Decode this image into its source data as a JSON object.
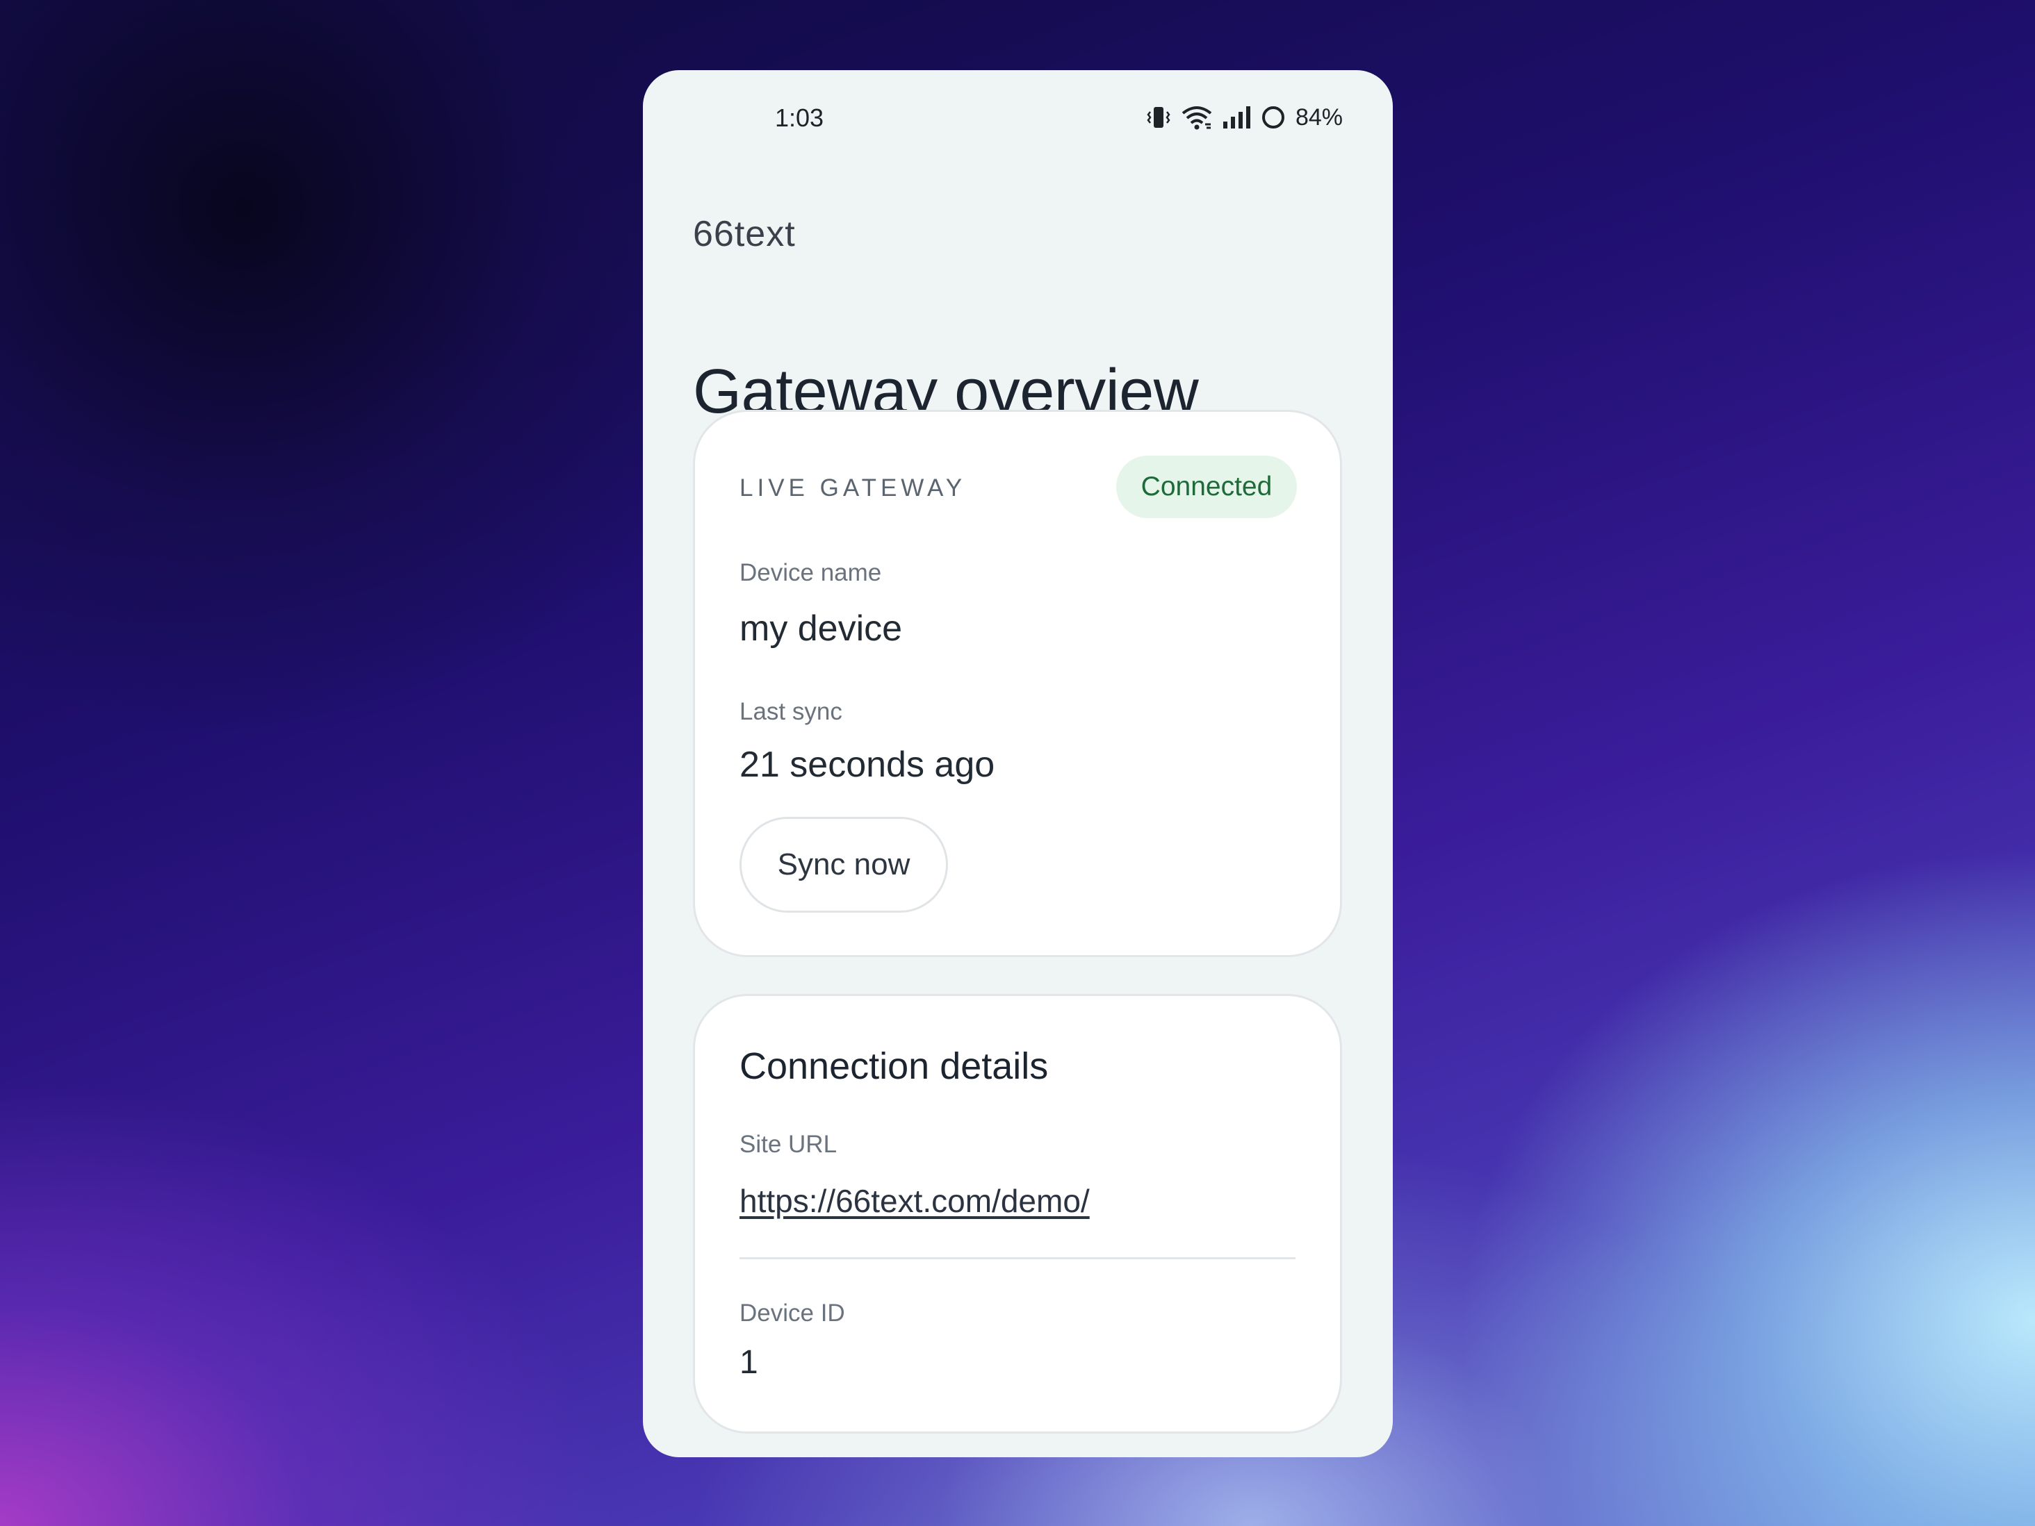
{
  "status_bar": {
    "time": "1:03",
    "icons": [
      "vibrate-icon",
      "wifi-icon",
      "signal-icon",
      "battery-ring-icon"
    ],
    "battery": "84%"
  },
  "app": {
    "brand": "66text",
    "title": "Gateway overview"
  },
  "gateway_card": {
    "eyebrow": "LIVE GATEWAY",
    "status_badge": "Connected",
    "device_name_label": "Device name",
    "device_name_value": "my device",
    "last_sync_label": "Last sync",
    "last_sync_value": "21 seconds ago",
    "sync_button": "Sync now"
  },
  "details_card": {
    "title": "Connection details",
    "site_url_label": "Site URL",
    "site_url_value": "https://66text.com/demo/",
    "device_id_label": "Device ID",
    "device_id_value": "1"
  },
  "colors": {
    "screen_bg": "#eff5f5",
    "card_bg": "#ffffff",
    "badge_bg": "#e6f5ea",
    "badge_text": "#1f6a3a",
    "text_primary": "#1c2430",
    "text_secondary": "#6a737d"
  }
}
